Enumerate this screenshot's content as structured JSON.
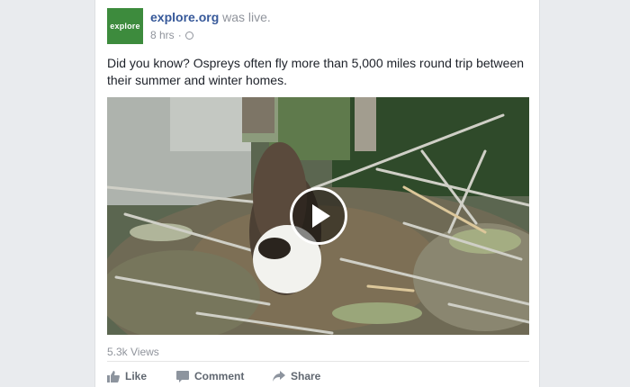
{
  "post": {
    "page_name": "explore.org",
    "action_text": "was live.",
    "logo_text": "explore",
    "timestamp": "8 hrs",
    "separator": "·",
    "privacy_icon": "globe-icon",
    "text": "Did you know? Ospreys often fly more than 5,000 miles round trip between their summer and winter homes.",
    "video": {
      "play_icon": "play-icon"
    },
    "views": "5.3k Views"
  },
  "actions": [
    {
      "label": "Like",
      "icon": "thumbs-up-icon"
    },
    {
      "label": "Comment",
      "icon": "comment-icon"
    },
    {
      "label": "Share",
      "icon": "share-icon"
    }
  ],
  "colors": {
    "link": "#365899",
    "muted": "#90949c",
    "logo_bg": "#3d8b3d",
    "page_bg": "#e9ebee"
  }
}
